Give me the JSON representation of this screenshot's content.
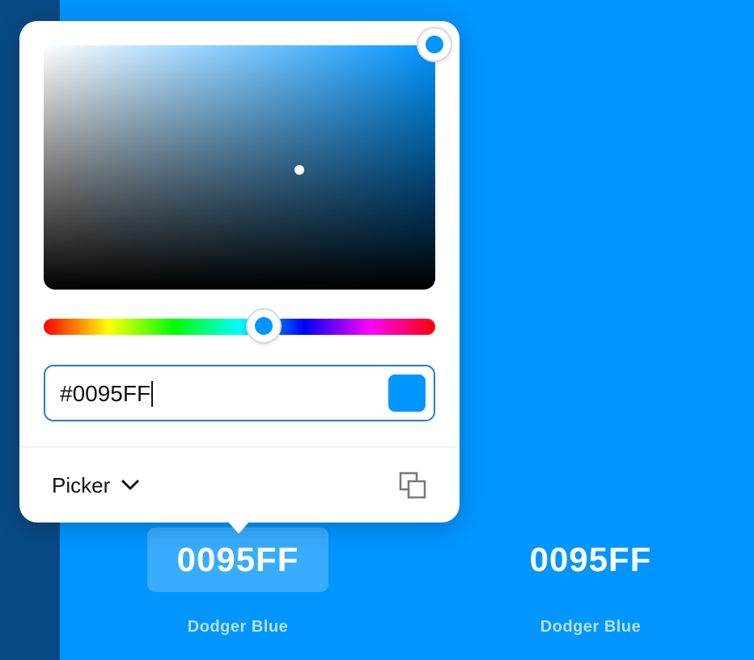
{
  "colors": {
    "background": "#0095FF",
    "left_strip": "#094a86",
    "current_color": "#0095FF",
    "hue_color": "#0095FF",
    "input_border": "#1f7ae0"
  },
  "picker": {
    "hex_value": "#0095FF",
    "mode_label": "Picker",
    "mode_icon": "chevron-down-icon",
    "copy_icon": "copy-icon",
    "hue_degrees": 205,
    "saturation_value_marker": "center"
  },
  "swatches": [
    {
      "hex": "0095FF",
      "name": "Dodger Blue",
      "selected": true
    },
    {
      "hex": "0095FF",
      "name": "Dodger Blue",
      "selected": false
    }
  ]
}
